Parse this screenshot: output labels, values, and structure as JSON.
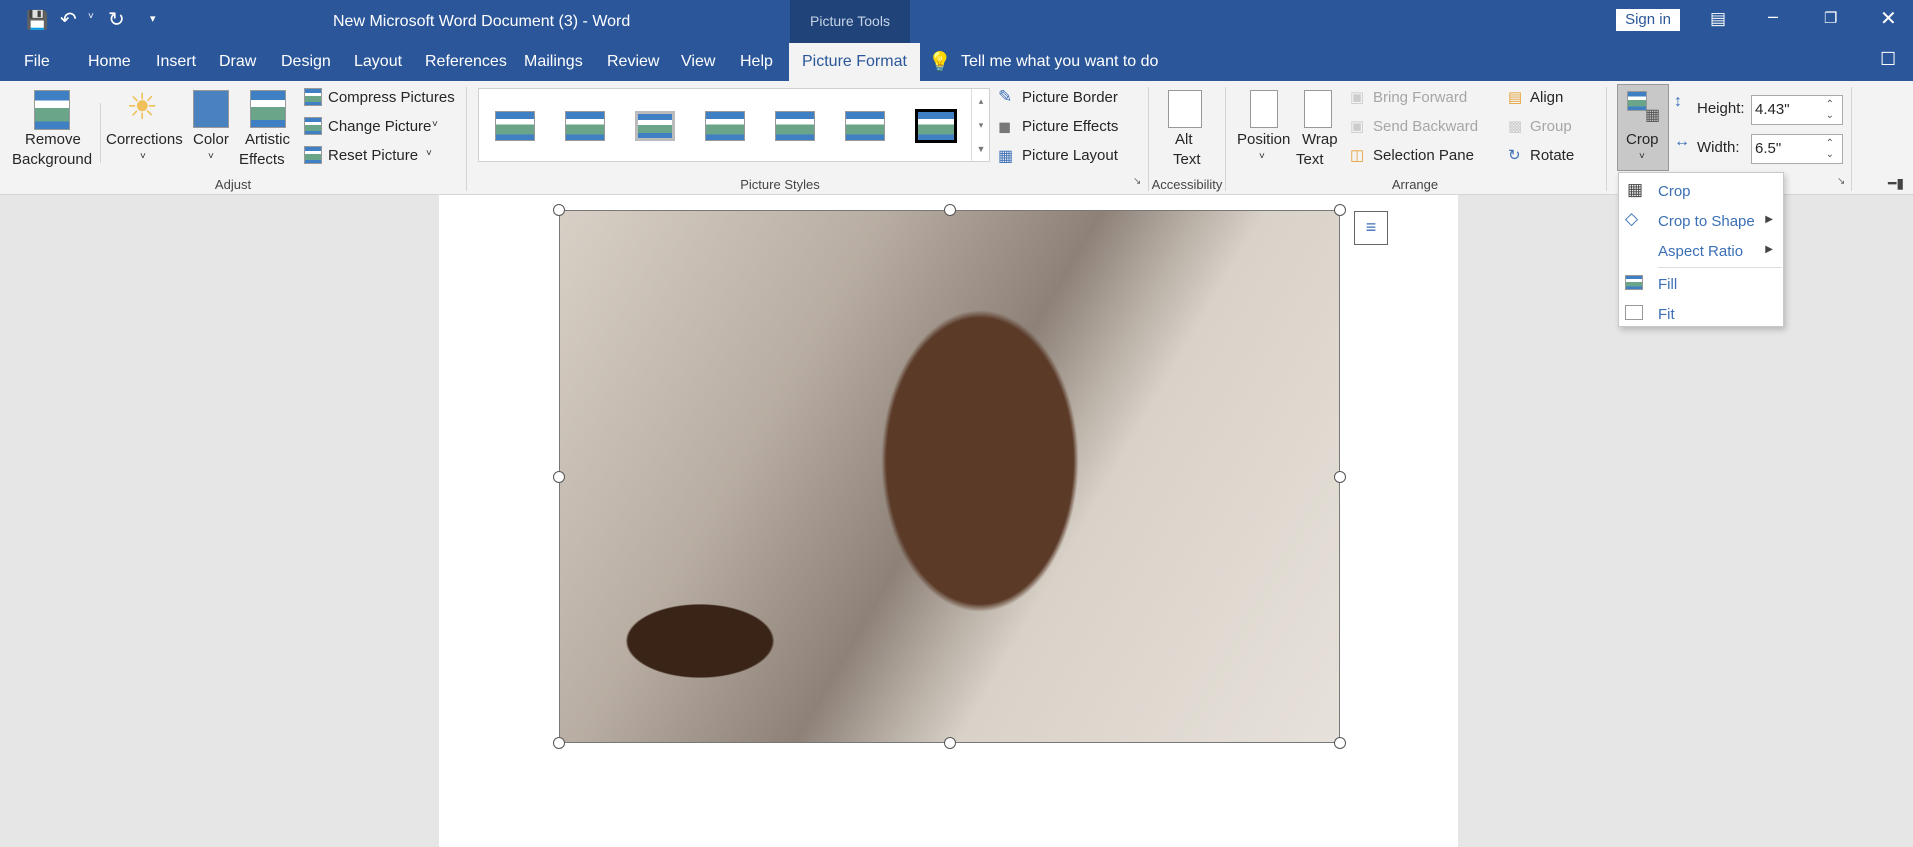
{
  "titlebar": {
    "title": "New Microsoft Word Document (3)  -  Word",
    "context": "Picture Tools",
    "sign_in": "Sign in"
  },
  "tabs": [
    "File",
    "Home",
    "Insert",
    "Draw",
    "Design",
    "Layout",
    "References",
    "Mailings",
    "Review",
    "View",
    "Help",
    "Picture Format"
  ],
  "active_tab": "Picture Format",
  "tell_me": "Tell me what you want to do",
  "adjust": {
    "remove_bg": [
      "Remove",
      "Background"
    ],
    "corrections": "Corrections",
    "color": "Color",
    "artistic": [
      "Artistic",
      "Effects"
    ],
    "compress": "Compress Pictures",
    "change": "Change Picture",
    "reset": "Reset Picture",
    "group": "Adjust"
  },
  "styles": {
    "group": "Picture Styles",
    "border": "Picture Border",
    "effects": "Picture Effects",
    "layout": "Picture Layout"
  },
  "accessibility": {
    "alt": [
      "Alt",
      "Text"
    ],
    "group": "Accessibility"
  },
  "arrange": {
    "position": "Position",
    "wrap": [
      "Wrap",
      "Text"
    ],
    "bring": "Bring Forward",
    "send": "Send Backward",
    "selection": "Selection Pane",
    "align": "Align",
    "group_btn": "Group",
    "rotate": "Rotate",
    "group": "Arrange"
  },
  "size": {
    "crop": "Crop",
    "height_label": "Height:",
    "height": "4.43\"",
    "width_label": "Width:",
    "width": "6.5\""
  },
  "crop_menu": [
    "Crop",
    "Crop to Shape",
    "Aspect Ratio",
    "Fill",
    "Fit"
  ],
  "colors": {
    "brand": "#2b579a",
    "menu_text": "#3b6fb6"
  }
}
